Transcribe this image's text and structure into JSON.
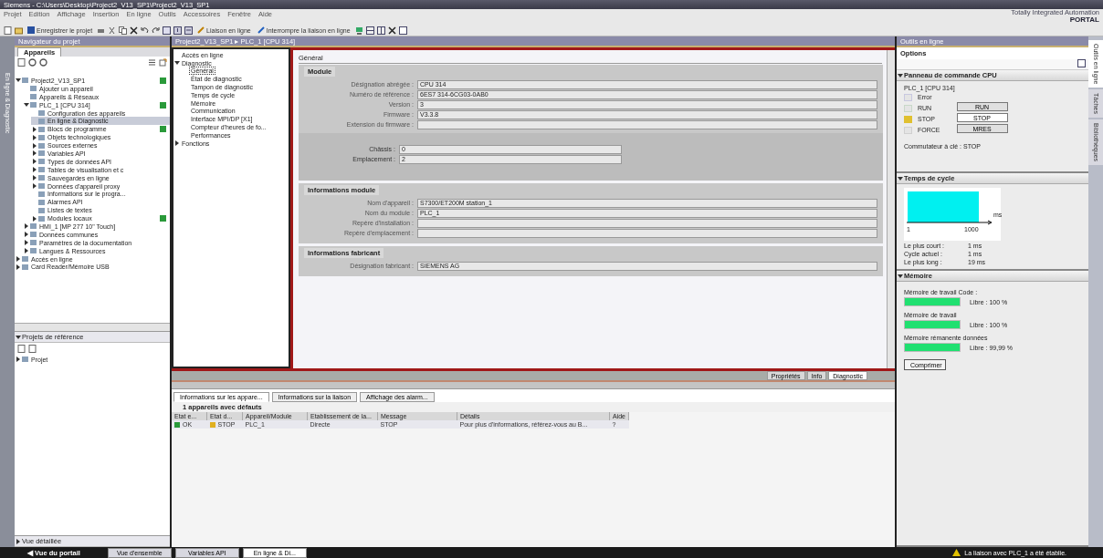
{
  "window": {
    "title": "Siemens - C:\\Users\\Desktop\\Project2_V13_SP1\\Project2_V13_SP1"
  },
  "menu": [
    "Projet",
    "Edition",
    "Affichage",
    "Insertion",
    "En ligne",
    "Outils",
    "Accessoires",
    "Fenêtre",
    "Aide"
  ],
  "brand": {
    "line1": "Totally Integrated Automation",
    "line2": "PORTAL"
  },
  "toolbar": {
    "save": "Enregistrer le projet",
    "connect": "Liaison en ligne",
    "disconnect": "Interrompre la liaison en ligne"
  },
  "headers": {
    "navigator": "Navigateur du projet",
    "breadcrumb": "Project2_V13_SP1 ▸ PLC_1 [CPU 314]",
    "tools": "Outils en ligne"
  },
  "left_strip": "En ligne & Diagnostic",
  "devices_tab": "Appareils",
  "tree": [
    {
      "label": "Project2_V13_SP1",
      "expanded": true,
      "online_ok": true,
      "children": [
        {
          "label": "Ajouter un appareil"
        },
        {
          "label": "Appareils & Réseaux"
        },
        {
          "label": "PLC_1 [CPU 314]",
          "expanded": true,
          "online_ok": true,
          "children": [
            {
              "label": "Configuration des appareils"
            },
            {
              "label": "En ligne & Diagnostic",
              "selected": true
            },
            {
              "label": "Blocs de programme",
              "expanded": false,
              "online_ok": true
            },
            {
              "label": "Objets technologiques",
              "expanded": false
            },
            {
              "label": "Sources externes",
              "expanded": false
            },
            {
              "label": "Variables API",
              "expanded": false
            },
            {
              "label": "Types de données API",
              "expanded": false
            },
            {
              "label": "Tables de visualisation et c",
              "expanded": false
            },
            {
              "label": "Sauvegardes en ligne",
              "expanded": false
            },
            {
              "label": "Données d'appareil proxy",
              "expanded": false
            },
            {
              "label": "Informations sur le progra..."
            },
            {
              "label": "Alarmes API"
            },
            {
              "label": "Listes de textes"
            },
            {
              "label": "Modules locaux",
              "expanded": false,
              "online_ok": true
            }
          ]
        },
        {
          "label": "HMI_1 [MP 277 10\" Touch]",
          "expanded": false
        },
        {
          "label": "Données communes",
          "expanded": false
        },
        {
          "label": "Paramètres de la documentation",
          "expanded": false
        },
        {
          "label": "Langues & Ressources",
          "expanded": false
        }
      ]
    },
    {
      "label": "Accès en ligne",
      "expanded": false
    },
    {
      "label": "Card Reader/Mémoire USB",
      "expanded": false
    }
  ],
  "reference": {
    "title": "Projets de référence",
    "items": [
      {
        "label": "Projet",
        "expanded": false
      }
    ]
  },
  "details": "Vue détaillée",
  "nav": [
    {
      "label": "Accès en ligne",
      "selected": false
    },
    {
      "label": "Diagnostic",
      "expanded": true,
      "selected": false,
      "children": [
        {
          "label": "Général",
          "selected": true
        },
        {
          "label": "État de diagnostic",
          "selected": false
        },
        {
          "label": "Tampon de diagnostic",
          "selected": false
        },
        {
          "label": "Temps de cycle",
          "selected": false
        },
        {
          "label": "Mémoire",
          "selected": false
        },
        {
          "label": "Communication",
          "selected": false
        },
        {
          "label": "Interface MPI/DP [X1]",
          "selected": false
        },
        {
          "label": "Compteur d'heures de fo...",
          "selected": false
        },
        {
          "label": "Performances",
          "selected": false
        }
      ]
    },
    {
      "label": "Fonctions",
      "expanded": false,
      "selected": false
    }
  ],
  "general": {
    "title": "Général",
    "sections": [
      {
        "title": "Module",
        "fields": [
          {
            "label": "Désignation abrégée :",
            "value": "CPU 314"
          },
          {
            "label": "Numéro de référence :",
            "value": "6ES7 314-6CG03-0AB0"
          },
          {
            "label": "Version :",
            "value": "3"
          },
          {
            "label": "Firmware :",
            "value": "V3.3.8"
          },
          {
            "label": "Extension du firmware :"
          }
        ],
        "sub_fields": [
          {
            "label": "Châssis :",
            "value": "0"
          },
          {
            "label": "Emplacement :",
            "value": "2"
          }
        ]
      },
      {
        "title": "Informations module",
        "fields": [
          {
            "label": "Nom d'appareil :",
            "value": "S7300/ET200M station_1"
          },
          {
            "label": "Nom du module :",
            "value": "PLC_1"
          },
          {
            "label": "Repère d'installation :"
          },
          {
            "label": "Repère d'emplacement :"
          }
        ]
      },
      {
        "title": "Informations fabricant",
        "fields": [
          {
            "label": "Désignation fabricant :",
            "value": "SIEMENS AG"
          }
        ]
      }
    ]
  },
  "inspector_tabs": [
    {
      "label": "Propriétés",
      "selected": false
    },
    {
      "label": "Info",
      "selected": false
    },
    {
      "label": "Diagnostic",
      "selected": true
    }
  ],
  "sub_tabs": [
    {
      "label": "Informations sur les appare...",
      "selected": true
    },
    {
      "label": "Informations sur la liaison",
      "selected": false
    },
    {
      "label": "Affichage des alarm...",
      "selected": false
    }
  ],
  "fault_count": "1 appareils avec défauts",
  "table": {
    "columns": [
      "Etat e...",
      "Etat d...",
      "Appareil/Module",
      "Etablissement de la...",
      "Message",
      "Détails",
      "Aide"
    ],
    "rows": [
      {
        "cells": [
          "OK",
          "STOP",
          "PLC_1",
          "Directe",
          "STOP",
          "Pour plus d'informations, référez-vous au B...",
          "?"
        ]
      }
    ]
  },
  "options": "Options",
  "cpu_panel": {
    "title": "Panneau de commande CPU",
    "device": "PLC_1 [CPU 314]",
    "leds": [
      {
        "label": "Error",
        "on": false,
        "color": "#c8c8e0"
      },
      {
        "label": "RUN",
        "on": false,
        "color": "#c8d8c8"
      },
      {
        "label": "STOP",
        "on": true,
        "color": "#e0c030"
      },
      {
        "label": "FORCE",
        "on": false,
        "color": "#d0d0d0"
      }
    ],
    "buttons": [
      {
        "label": "RUN",
        "selected": false
      },
      {
        "label": "STOP",
        "selected": true
      },
      {
        "label": "MRES",
        "selected": false
      }
    ],
    "key_switch": "Commutateur à clé : STOP"
  },
  "cycle": {
    "title": "Temps de cycle",
    "axis_start": "1",
    "axis_end": "1000",
    "unit": "ms",
    "stats": [
      {
        "label": "Le plus court :",
        "value": "1 ms"
      },
      {
        "label": "Cycle actuel :",
        "value": "1 ms"
      },
      {
        "label": "Le plus long :",
        "value": "19 ms"
      }
    ]
  },
  "memory": {
    "title": "Mémoire",
    "items": [
      {
        "label": "Mémoire de travail Code :",
        "level": 1,
        "reading": "Libre : 100 %"
      },
      {
        "label": "Mémoire de travail",
        "level": 1,
        "reading": "Libre : 100 %"
      },
      {
        "label": "Mémoire rémanente données",
        "level": 0.9999,
        "reading": "Libre : 99,99 %"
      }
    ],
    "button": "Comprimer"
  },
  "right_tabs": [
    {
      "label": "Outils en ligne",
      "selected": true
    },
    {
      "label": "Tâches",
      "selected": false
    },
    {
      "label": "Bibliothèques",
      "selected": false
    }
  ],
  "taskbar": {
    "portal": "◀ Vue du portail",
    "items": [
      {
        "label": "Vue d'ensemble",
        "selected": false
      },
      {
        "label": "Variables API",
        "selected": false
      },
      {
        "label": "En ligne & Di...",
        "selected": true
      }
    ],
    "status": "La liaison avec PLC_1 a été établie."
  }
}
